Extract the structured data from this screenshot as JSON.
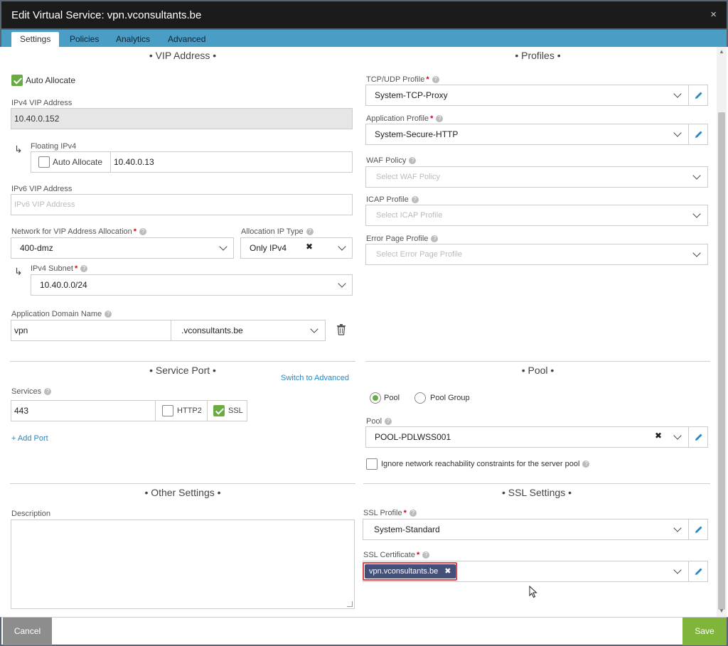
{
  "window": {
    "title": "Edit Virtual Service: vpn.vconsultants.be",
    "close_glyph": "×"
  },
  "tabs": [
    {
      "label": "Settings"
    },
    {
      "label": "Policies"
    },
    {
      "label": "Analytics"
    },
    {
      "label": "Advanced"
    }
  ],
  "vip": {
    "section_title": "• VIP Address •",
    "auto_allocate_label": "Auto Allocate",
    "ipv4_label": "IPv4 VIP Address",
    "ipv4_value": "10.40.0.152",
    "floating_label": "Floating IPv4",
    "floating_auto_label": "Auto Allocate",
    "floating_value": "10.40.0.13",
    "ipv6_label": "IPv6 VIP Address",
    "ipv6_placeholder": "IPv6 VIP Address",
    "network_label": "Network for VIP Address Allocation",
    "network_value": "400-dmz",
    "alloc_type_label": "Allocation IP Type",
    "alloc_type_value": "Only IPv4",
    "subnet_label": "IPv4 Subnet",
    "subnet_value": "10.40.0.0/24",
    "domain_label": "Application Domain Name",
    "domain_value": "vpn",
    "domain_suffix": ".vconsultants.be"
  },
  "profiles": {
    "section_title": "• Profiles •",
    "tcp_label": "TCP/UDP Profile",
    "tcp_value": "System-TCP-Proxy",
    "app_label": "Application Profile",
    "app_value": "System-Secure-HTTP",
    "waf_label": "WAF Policy",
    "waf_placeholder": "Select WAF Policy",
    "icap_label": "ICAP Profile",
    "icap_placeholder": "Select ICAP Profile",
    "error_label": "Error Page Profile",
    "error_placeholder": "Select Error Page Profile"
  },
  "service_port": {
    "section_title": "• Service Port •",
    "switch_link": "Switch to Advanced",
    "services_label": "Services",
    "port_value": "443",
    "http2_label": "HTTP2",
    "ssl_label": "SSL",
    "add_port": "+ Add Port"
  },
  "pool": {
    "section_title": "• Pool •",
    "radio_pool": "Pool",
    "radio_pool_group": "Pool Group",
    "pool_label": "Pool",
    "pool_value": "POOL-PDLWSS001",
    "ignore_label": "Ignore network reachability constraints for the server pool"
  },
  "other": {
    "section_title": "• Other Settings •",
    "description_label": "Description"
  },
  "ssl": {
    "section_title": "• SSL Settings •",
    "profile_label": "SSL Profile",
    "profile_value": "System-Standard",
    "cert_label": "SSL Certificate",
    "cert_chip": "vpn.vconsultants.be"
  },
  "footer": {
    "cancel_label": "Cancel",
    "save_label": "Save"
  },
  "colors": {
    "accent_green": "#7fb53b",
    "tab_blue": "#4a9dc4",
    "chip_navy": "#45507a",
    "highlight_red": "#e0434b"
  }
}
